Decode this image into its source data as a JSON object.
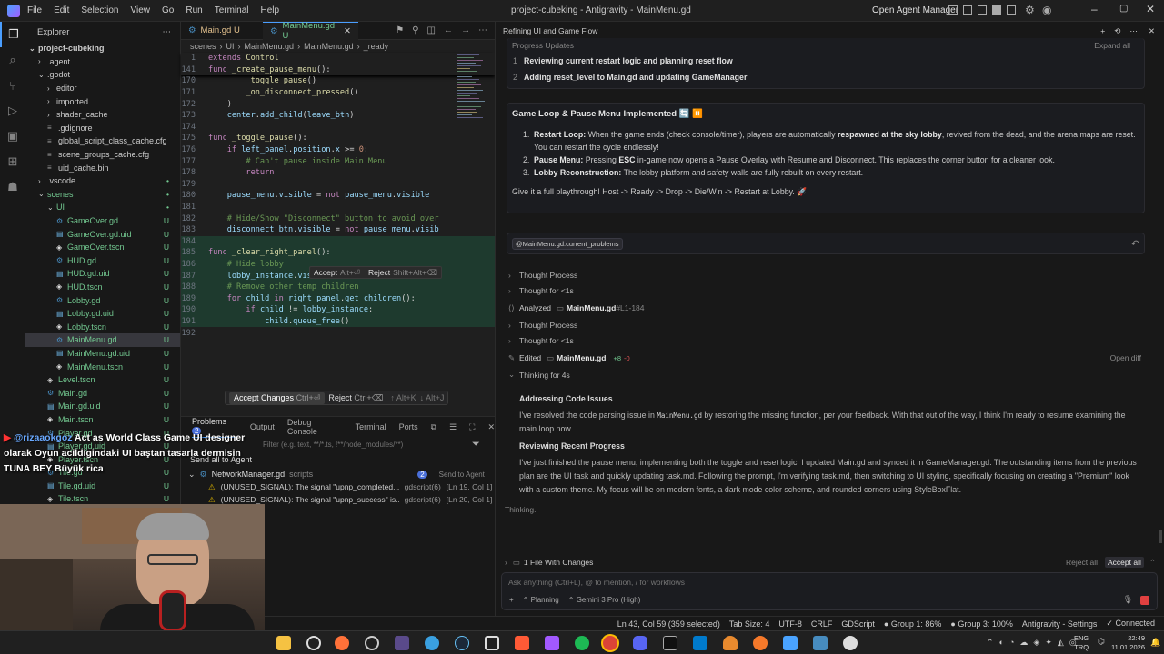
{
  "titlebar": {
    "menu": [
      "File",
      "Edit",
      "Selection",
      "View",
      "Go",
      "Run",
      "Terminal",
      "Help"
    ],
    "title": "project-cubeking - Antigravity - MainMenu.gd",
    "open_agent_manager": "Open Agent Manager"
  },
  "explorer": {
    "title": "Explorer",
    "root": "project-cubeking",
    "items": [
      {
        "label": ".agent",
        "type": "folder",
        "open": false,
        "depth": 1,
        "status": "",
        "color": "#cccccc"
      },
      {
        "label": ".godot",
        "type": "folder",
        "open": true,
        "depth": 1,
        "status": "",
        "color": "#cccccc"
      },
      {
        "label": "editor",
        "type": "folder",
        "open": false,
        "depth": 2,
        "status": "",
        "color": "#cccccc"
      },
      {
        "label": "imported",
        "type": "folder",
        "open": false,
        "depth": 2,
        "status": "",
        "color": "#cccccc"
      },
      {
        "label": "shader_cache",
        "type": "folder",
        "open": false,
        "depth": 2,
        "status": "",
        "color": "#cccccc"
      },
      {
        "label": ".gdignore",
        "type": "file",
        "depth": 2,
        "status": "",
        "color": "#cccccc"
      },
      {
        "label": "global_script_class_cache.cfg",
        "type": "file",
        "depth": 2,
        "status": "",
        "color": "#cccccc"
      },
      {
        "label": "scene_groups_cache.cfg",
        "type": "file",
        "depth": 2,
        "status": "",
        "color": "#cccccc"
      },
      {
        "label": "uid_cache.bin",
        "type": "file",
        "depth": 2,
        "status": "",
        "color": "#cccccc"
      },
      {
        "label": ".vscode",
        "type": "folder",
        "open": false,
        "depth": 1,
        "status": "•",
        "color": "#cccccc"
      },
      {
        "label": "scenes",
        "type": "folder",
        "open": true,
        "depth": 1,
        "status": "•",
        "color": "#73c991"
      },
      {
        "label": "UI",
        "type": "folder",
        "open": true,
        "depth": 2,
        "status": "•",
        "color": "#73c991"
      },
      {
        "label": "GameOver.gd",
        "type": "file",
        "depth": 3,
        "status": "U",
        "color": "#73c991"
      },
      {
        "label": "GameOver.gd.uid",
        "type": "file",
        "depth": 3,
        "status": "U",
        "color": "#73c991"
      },
      {
        "label": "GameOver.tscn",
        "type": "file",
        "depth": 3,
        "status": "U",
        "color": "#73c991"
      },
      {
        "label": "HUD.gd",
        "type": "file",
        "depth": 3,
        "status": "U",
        "color": "#73c991"
      },
      {
        "label": "HUD.gd.uid",
        "type": "file",
        "depth": 3,
        "status": "U",
        "color": "#73c991"
      },
      {
        "label": "HUD.tscn",
        "type": "file",
        "depth": 3,
        "status": "U",
        "color": "#73c991"
      },
      {
        "label": "Lobby.gd",
        "type": "file",
        "depth": 3,
        "status": "U",
        "color": "#73c991"
      },
      {
        "label": "Lobby.gd.uid",
        "type": "file",
        "depth": 3,
        "status": "U",
        "color": "#73c991"
      },
      {
        "label": "Lobby.tscn",
        "type": "file",
        "depth": 3,
        "status": "U",
        "color": "#73c991"
      },
      {
        "label": "MainMenu.gd",
        "type": "file",
        "depth": 3,
        "status": "U",
        "color": "#73c991",
        "selected": true
      },
      {
        "label": "MainMenu.gd.uid",
        "type": "file",
        "depth": 3,
        "status": "U",
        "color": "#73c991"
      },
      {
        "label": "MainMenu.tscn",
        "type": "file",
        "depth": 3,
        "status": "U",
        "color": "#73c991"
      },
      {
        "label": "Level.tscn",
        "type": "file",
        "depth": 2,
        "status": "U",
        "color": "#73c991"
      },
      {
        "label": "Main.gd",
        "type": "file",
        "depth": 2,
        "status": "U",
        "color": "#73c991"
      },
      {
        "label": "Main.gd.uid",
        "type": "file",
        "depth": 2,
        "status": "U",
        "color": "#73c991"
      },
      {
        "label": "Main.tscn",
        "type": "file",
        "depth": 2,
        "status": "U",
        "color": "#73c991"
      },
      {
        "label": "Player.gd",
        "type": "file",
        "depth": 2,
        "status": "U",
        "color": "#73c991"
      },
      {
        "label": "Player.gd.uid",
        "type": "file",
        "depth": 2,
        "status": "U",
        "color": "#73c991"
      },
      {
        "label": "Player.tscn",
        "type": "file",
        "depth": 2,
        "status": "U",
        "color": "#73c991"
      },
      {
        "label": "Tile.gd",
        "type": "file",
        "depth": 2,
        "status": "U",
        "color": "#73c991"
      },
      {
        "label": "Tile.gd.uid",
        "type": "file",
        "depth": 2,
        "status": "U",
        "color": "#73c991"
      },
      {
        "label": "Tile.tscn",
        "type": "file",
        "depth": 2,
        "status": "U",
        "color": "#73c991"
      }
    ]
  },
  "editor": {
    "tabs": [
      {
        "label": "Main.gd U",
        "active": false
      },
      {
        "label": "MainMenu.gd U",
        "active": true
      }
    ],
    "breadcrumb": [
      "scenes",
      "UI",
      "MainMenu.gd",
      "MainMenu.gd",
      "_ready"
    ],
    "sticky_lines": [
      {
        "n": "1",
        "code": "extends Control"
      },
      {
        "n": "141",
        "code": "func _create_pause_menu():"
      }
    ],
    "lines": [
      {
        "n": "170",
        "code": "        _toggle_pause()"
      },
      {
        "n": "171",
        "code": "        _on_disconnect_pressed()"
      },
      {
        "n": "172",
        "code": "    )"
      },
      {
        "n": "173",
        "code": "    center.add_child(leave_btn)"
      },
      {
        "n": "174",
        "code": ""
      },
      {
        "n": "175",
        "code": "func _toggle_pause():"
      },
      {
        "n": "176",
        "code": "    if left_panel.position.x >= 0:"
      },
      {
        "n": "177",
        "code": "        # Can't pause inside Main Menu"
      },
      {
        "n": "178",
        "code": "        return"
      },
      {
        "n": "179",
        "code": ""
      },
      {
        "n": "180",
        "code": "    pause_menu.visible = not pause_menu.visible"
      },
      {
        "n": "181",
        "code": ""
      },
      {
        "n": "182",
        "code": "    # Hide/Show \"Disconnect\" button to avoid over"
      },
      {
        "n": "183",
        "code": "    disconnect_btn.visible = not pause_menu.visib"
      },
      {
        "n": "184",
        "code": ""
      },
      {
        "n": "185",
        "code": "func _clear_right_panel():"
      },
      {
        "n": "186",
        "code": "    # Hide lobby"
      },
      {
        "n": "187",
        "code": "    lobby_instance.visible = false"
      },
      {
        "n": "188",
        "code": "    # Remove other temp children"
      },
      {
        "n": "189",
        "code": "    for child in right_panel.get_children():"
      },
      {
        "n": "190",
        "code": "        if child != lobby_instance:"
      },
      {
        "n": "191",
        "code": "            child.queue_free()"
      },
      {
        "n": "192",
        "code": ""
      }
    ],
    "inline_accept": "Accept",
    "inline_accept_key": "Alt+⏎",
    "inline_reject": "Reject",
    "inline_reject_key": "Shift+Alt+⌫",
    "accept_changes": "Accept Changes",
    "accept_changes_key": "Ctrl+⏎",
    "reject": "Reject",
    "reject_key": "Ctrl+⌫",
    "nav_prev": "↑ Alt+K",
    "nav_next": "↓ Alt+J"
  },
  "panel": {
    "tabs": [
      "Problems",
      "Output",
      "Debug Console",
      "Terminal",
      "Ports"
    ],
    "problems_count": "2",
    "filter_placeholder": "Filter (e.g. text, **/*.ts, !**/node_modules/**)",
    "send_all": "Send all to Agent",
    "file": "NetworkManager.gd",
    "file_dir": "scripts",
    "file_count": "2",
    "send_to_agent": "Send to Agent",
    "problems": [
      {
        "text": "(UNUSED_SIGNAL): The signal \"upnp_completed...",
        "src": "gdscript(6)",
        "loc": "[Ln 19, Col 1]"
      },
      {
        "text": "(UNUSED_SIGNAL): The signal \"upnp_success\" is...",
        "src": "gdscript(6)",
        "loc": "[Ln 20, Col 1]"
      }
    ]
  },
  "agent": {
    "header_title": "Refining UI and Game Flow",
    "progress_label": "Progress Updates",
    "expand_all": "Expand all",
    "progress_items": [
      {
        "n": "1",
        "text": "Reviewing current restart logic and planning reset flow"
      },
      {
        "n": "2",
        "text": "Adding reset_level to Main.gd and updating GameManager"
      }
    ],
    "card_title": "Game Loop & Pause Menu Implemented 🔄 ⏸️",
    "list": [
      {
        "n": "1.",
        "bold": "Restart Loop:",
        "rest": " When the game ends (check console/timer), players are automatically ",
        "bold2": "respawned at the sky lobby",
        "rest2": ", revived from the dead, and the arena maps are reset. You can restart the cycle endlessly!"
      },
      {
        "n": "2.",
        "bold": "Pause Menu:",
        "rest": " Pressing ",
        "bold2": "ESC",
        "rest2": " in-game now opens a Pause Overlay with Resume and Disconnect. This replaces the corner button for a cleaner look."
      },
      {
        "n": "3.",
        "bold": "Lobby Reconstruction:",
        "rest": " The lobby platform and safety walls are fully rebuilt on every restart.",
        "bold2": "",
        "rest2": ""
      }
    ],
    "playthrough": "Give it a full playthrough! Host -> Ready -> Drop -> Die/Win -> Restart at Lobby. 🚀",
    "mention": "@MainMenu.gd:current_problems",
    "steps": [
      {
        "label": "Thought Process",
        "kind": "collapsed"
      },
      {
        "label": "Thought for <1s",
        "kind": "collapsed"
      },
      {
        "label": "Analyzed",
        "file": "MainMenu.gd",
        "extra": "#L1-184",
        "kind": "file"
      },
      {
        "label": "Thought Process",
        "kind": "collapsed"
      },
      {
        "label": "Thought for <1s",
        "kind": "collapsed"
      },
      {
        "label": "Edited",
        "file": "MainMenu.gd",
        "extra_add": "+8",
        "extra_del": "-0",
        "open": "Open diff",
        "kind": "edit"
      },
      {
        "label": "Thinking for 4s",
        "kind": "expanded"
      }
    ],
    "think1_title": "Addressing Code Issues",
    "think1_a": "I've resolved the code parsing issue in ",
    "think1_code": "MainMenu.gd",
    "think1_b": " by restoring the missing function, per your feedback. With that out of the way, I think I'm ready to resume examining the main loop now.",
    "think2_title": "Reviewing Recent Progress",
    "think2_text": "I've just finished the pause menu, implementing both the toggle and reset logic. I updated Main.gd and synced it in GameManager.gd. The outstanding items from the previous plan are the UI task and quickly updating task.md. Following the prompt, I'm verifying task.md, then switching to UI styling, specifically focusing on creating a \"Premium\" look with a custom theme. My focus will be on modern fonts, a dark mode color scheme, and rounded corners using StyleBoxFlat.",
    "thinking": "Thinking.",
    "files_changed": "1 File With Changes",
    "reject_all": "Reject all",
    "accept_all": "Accept all",
    "input_placeholder": "Ask anything (Ctrl+L), @ to mention, / for workflows",
    "mode": "Planning",
    "model": "Gemini 3 Pro (High)"
  },
  "statusbar": {
    "items": [
      "Ln 43, Col 59 (359 selected)",
      "Tab Size: 4",
      "UTF-8",
      "CRLF",
      "GDScript",
      "● Group 1: 86%",
      "● Group 3: 100%",
      "Antigravity - Settings",
      "✓ Connected"
    ]
  },
  "overlay": {
    "handle": "@rizaaokgoz",
    "message": "Act as World Class Game UI designer olarak Oyun acildigindaki UI baştan tasarla dermisin TUNA BEY Büyük rica"
  },
  "taskbar": {
    "lang1": "ENG",
    "lang2": "TRQ",
    "time": "22:49",
    "date": "11.01.2026"
  }
}
